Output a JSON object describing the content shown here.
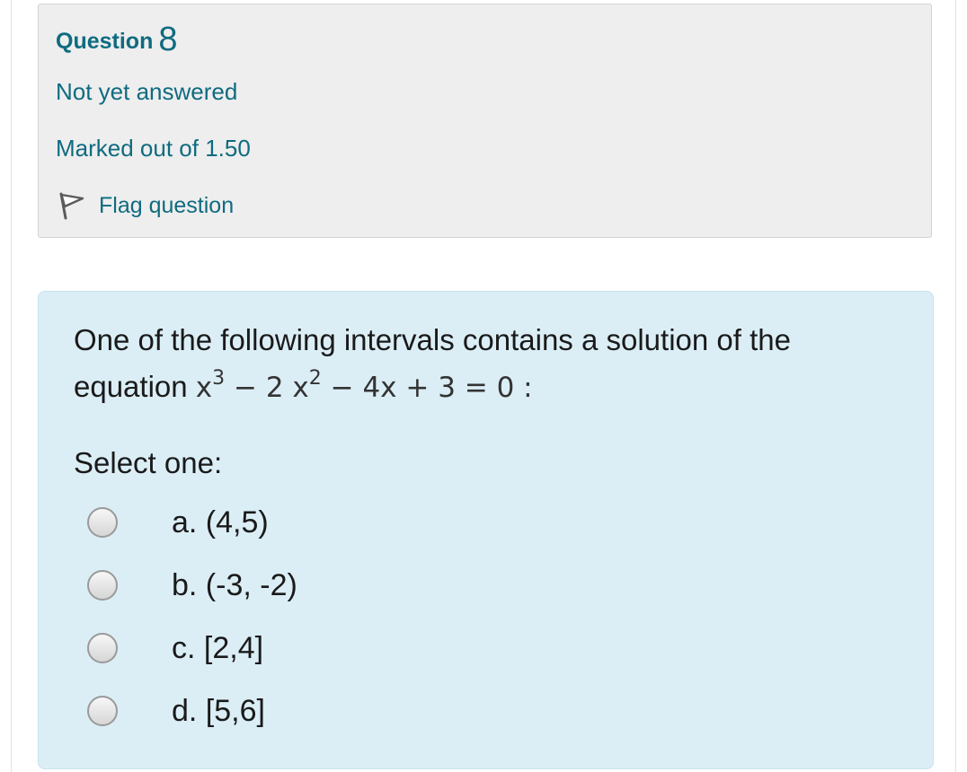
{
  "question": {
    "prefix": "Question",
    "number": "8",
    "state": "Not yet answered",
    "grade": "Marked out of 1.50",
    "flag_label": "Flag question",
    "flag_icon": "flag-icon"
  },
  "formulation": {
    "text_before": "One of the following intervals contains a solution of the equation ",
    "equation": {
      "base1": "x",
      "exp1": "3",
      "mid": " − 2 x",
      "exp2": "2",
      "tail": " − 4x + 3 = 0 :"
    },
    "prompt": "Select one:",
    "options": [
      {
        "label": "a. (4,5)",
        "selected": false
      },
      {
        "label": "b. (-3, -2)",
        "selected": false
      },
      {
        "label": "c. [2,4]",
        "selected": false
      },
      {
        "label": "d. [5,6]",
        "selected": false
      }
    ]
  },
  "colors": {
    "link": "#0f6b80",
    "info_bg": "#eeeeee",
    "formulation_bg": "#dbeef6"
  }
}
